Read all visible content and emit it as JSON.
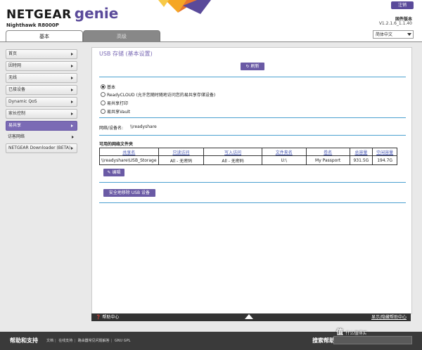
{
  "header": {
    "brand": "NETGEAR",
    "product": "genie",
    "model": "Nighthawk R8000P",
    "logout_label": "注销",
    "firmware_label": "固件版本",
    "firmware_version": "V1.2.1.6_1.1.40",
    "language": "简体中文",
    "tabs": [
      {
        "label": "基本"
      },
      {
        "label": "高级"
      }
    ]
  },
  "sidebar": {
    "items": [
      {
        "label": "首页"
      },
      {
        "label": "因特网"
      },
      {
        "label": "无线"
      },
      {
        "label": "已接设备"
      },
      {
        "label": "Dynamic QoS"
      },
      {
        "label": "家长控制"
      },
      {
        "label": "易共享"
      },
      {
        "label": "访客网络"
      },
      {
        "label": "NETGEAR Downloader (BETA)"
      }
    ]
  },
  "main": {
    "title": "USB 存储 (基本设置)",
    "refresh_label": "刷新",
    "options": [
      {
        "label": "基本",
        "selected": true
      },
      {
        "label": "ReadyCLOUD (允许您随时随地访问您的易共享存储设备)",
        "selected": false
      },
      {
        "label": "易共享打印",
        "selected": false
      },
      {
        "label": "易共享Vault",
        "selected": false
      }
    ],
    "device_name_label": "网络/设备名:",
    "device_name_value": "\\\\readyshare",
    "folders_label": "可用的网络文件夹",
    "table": {
      "headers": [
        "共享名",
        "只读访问",
        "写入访问",
        "文件夹名",
        "卷名",
        "总容量",
        "空闲容量"
      ],
      "rows": [
        [
          "\\\\readyshare\\USB_Storage",
          "All - 无密码",
          "All - 无密码",
          "U:\\",
          "My Passport",
          "931.5G",
          "194.7G"
        ]
      ]
    },
    "edit_label": "编辑",
    "safe_remove_label": "安全地移除 USB 设备"
  },
  "help_bar": {
    "left": "帮助中心",
    "right": "显示/隐藏帮助中心"
  },
  "footer": {
    "title": "帮助和支持",
    "links": [
      "文档",
      "在线支持",
      "路由器常见问题解答",
      "GNU GPL"
    ],
    "search_label": "搜索帮助"
  },
  "watermark": {
    "text": "值",
    "subtitle": "什么值得买"
  },
  "colors": {
    "accent": "#6a5aa5",
    "sidebar_active": "#7b6bb5",
    "divider": "#4aa0d0",
    "footer_bg": "#3a3a3a"
  }
}
